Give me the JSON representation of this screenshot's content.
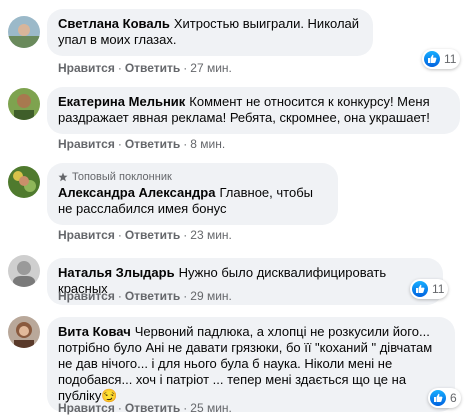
{
  "actions": {
    "like": "Нравится",
    "reply": "Ответить",
    "sep": "·"
  },
  "comments": [
    {
      "author": "Светлана Коваль",
      "text": "Хитростью выиграли. Николай упал в моих глазах.",
      "time": "27 мин.",
      "reactions": "11"
    },
    {
      "author": "Екатерина Мельник",
      "text": "Коммент не относится к конкурсу! Меня раздражает явная реклама! Ребята, скромнее, она украшает!",
      "time": "8 мин."
    },
    {
      "badge": "Топовый поклонник",
      "author": "Александра Александра",
      "text": "Главное, чтобы не расслабился имея бонус",
      "time": "23 мин."
    },
    {
      "author": "Наталья Злыдарь",
      "text": "Нужно было дисквалифицировать красных",
      "time": "29 мин.",
      "reactions": "11"
    },
    {
      "author": "Вита Ковач",
      "text": "Червоний падлюка, а хлопці не розкусили його... потрібно було Ані не давати грязюки, бо її \"коханий \" дівчатам не дав нічого... і для нього була б наука. Ніколи мені не подобався... хоч і патріот ... тепер мені здається що це на публіку😏",
      "time": "25 мин.",
      "reactions": "6"
    }
  ]
}
